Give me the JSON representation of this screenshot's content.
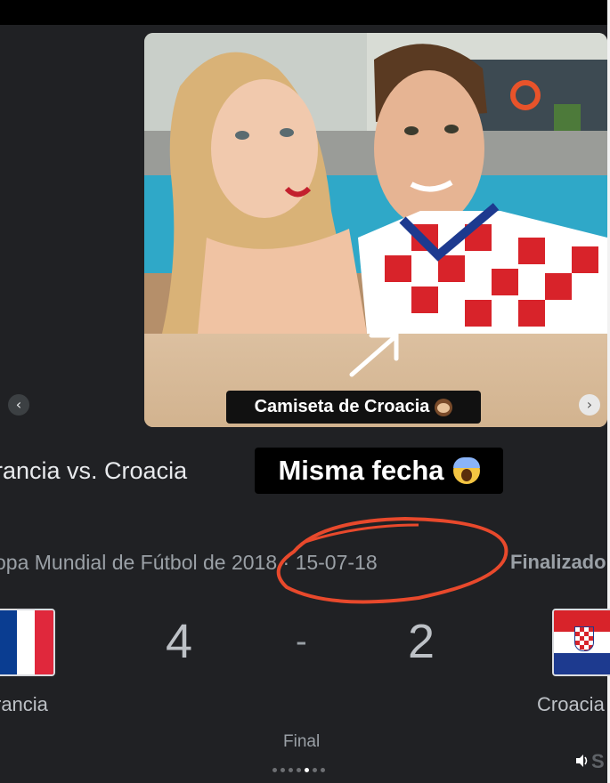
{
  "post": {
    "caption": "Camiseta de Croacia",
    "caption_emoji": "monkey-emoji",
    "overlay_text": "Misma fecha",
    "overlay_emoji": "screaming-face-emoji"
  },
  "match": {
    "title": "rancia vs. Croacia",
    "league_and_date": "opa Mundial de Fútbol de 2018 · 15-07-18",
    "status": "Finalizado",
    "home_team": "rancia",
    "away_team": "Croacia",
    "home_score": "4",
    "separator": "-",
    "away_score": "2",
    "result": "Final"
  },
  "carousel": {
    "prev_icon": "‹",
    "next_icon": "›",
    "dots": 7,
    "active_dot": 4
  },
  "watermark": "S",
  "colors": {
    "background": "#202124",
    "annotation_red": "#e8492c",
    "france_blue": "#0a3d91",
    "france_red": "#e0283c",
    "croatia_red": "#d8232a",
    "croatia_blue": "#1d3a8f"
  }
}
